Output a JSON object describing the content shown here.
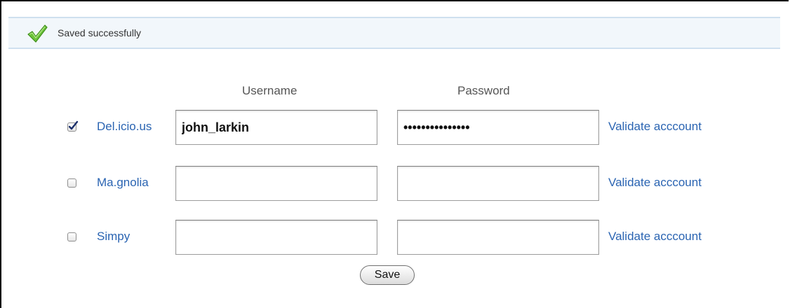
{
  "banner": {
    "message": "Saved successfully",
    "icon": "check-icon",
    "icon_color": "#5cb82e"
  },
  "headers": {
    "username": "Username",
    "password": "Password"
  },
  "accounts": [
    {
      "service": "Del.icio.us",
      "checked": true,
      "username": "john_larkin",
      "password_mask": "•••••••••••••••",
      "validate_label": "Validate acccount"
    },
    {
      "service": "Ma.gnolia",
      "checked": false,
      "username": "",
      "password_mask": "",
      "validate_label": "Validate acccount"
    },
    {
      "service": "Simpy",
      "checked": false,
      "username": "",
      "password_mask": "",
      "validate_label": "Validate acccount"
    }
  ],
  "save_label": "Save",
  "colors": {
    "link": "#2a64b2",
    "banner_bg": "#f2f7fb",
    "banner_border": "#cfe0ef"
  }
}
